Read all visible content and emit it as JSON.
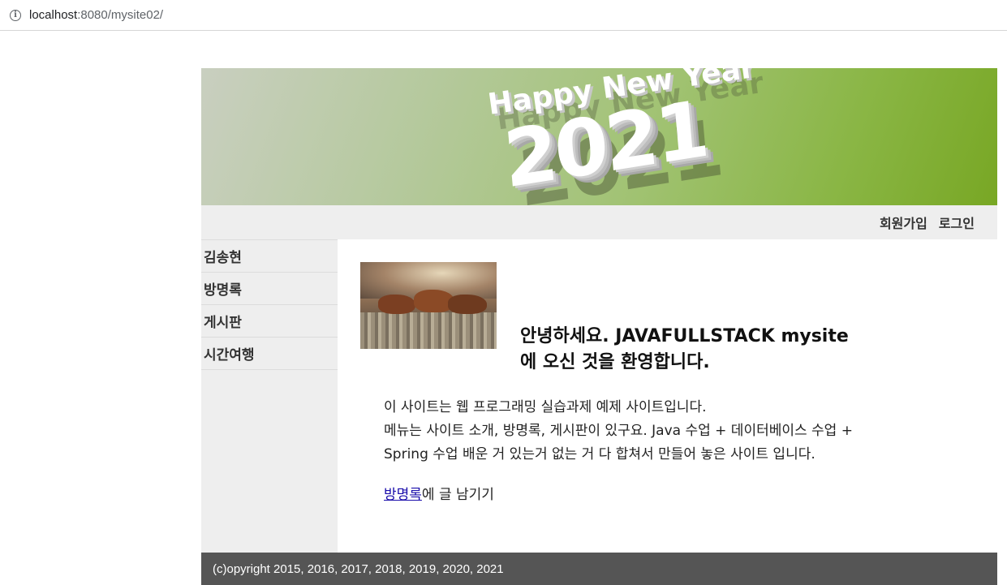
{
  "browser": {
    "url_host": "localhost",
    "url_rest": ":8080/mysite02/"
  },
  "header": {
    "banner_line1": "Happy New Year",
    "banner_year": "2021"
  },
  "topnav": {
    "join": "회원가입",
    "login": "로그인"
  },
  "sidebar": {
    "items": [
      {
        "label": "김송현"
      },
      {
        "label": "방명록"
      },
      {
        "label": "게시판"
      },
      {
        "label": "시간여행"
      }
    ]
  },
  "main": {
    "welcome_line1": "안녕하세요. JAVAFULLSTACK mysite",
    "welcome_line2": "에 오신 것을 환영합니다.",
    "desc_line1": "이 사이트는 웹 프로그래밍 실습과제 예제 사이트입니다.",
    "desc_line2": "메뉴는 사이트 소개, 방명록, 게시판이 있구요. Java 수업 + 데이터베이스 수업 +",
    "desc_line3": "Spring 수업 배운 거 있는거 없는 거 다 합쳐서 만들어 놓은 사이트 입니다.",
    "guestbook_link": "방명록",
    "guestbook_suffix": "에 글 남기기"
  },
  "footer": {
    "copyright": "(c)opyright 2015, 2016, 2017, 2018, 2019, 2020, 2021"
  }
}
